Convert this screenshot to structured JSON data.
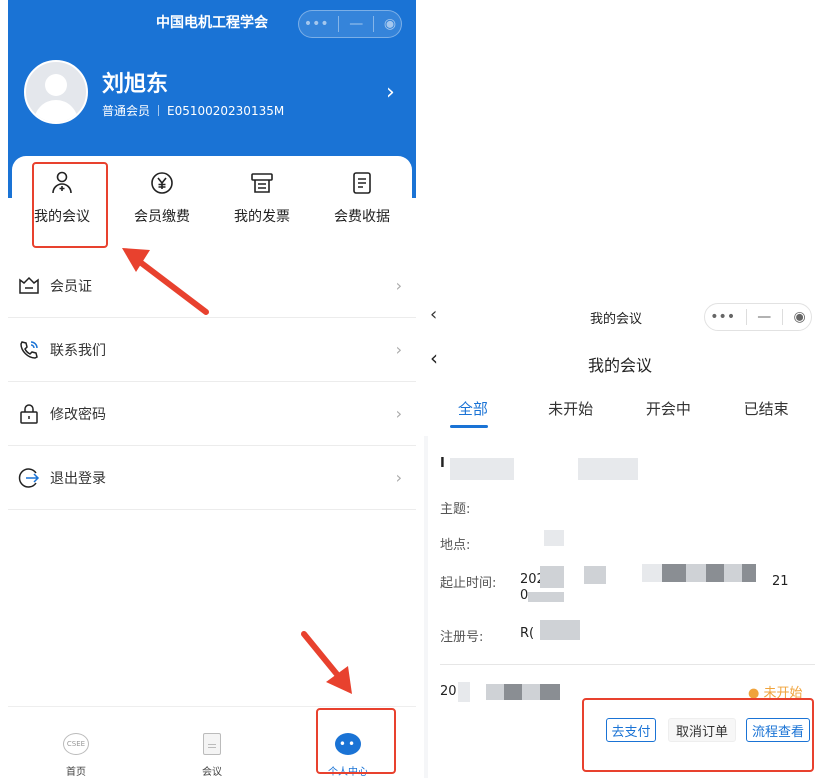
{
  "left": {
    "app_title": "中国电机工程学会",
    "user": {
      "name": "刘旭东",
      "level": "普通会员",
      "member_id": "E0510020230135M"
    },
    "quick_actions": [
      {
        "label": "我的会议",
        "icon": "meeting-person-icon"
      },
      {
        "label": "会员缴费",
        "icon": "yen-icon"
      },
      {
        "label": "我的发票",
        "icon": "invoice-icon"
      },
      {
        "label": "会费收据",
        "icon": "receipt-icon"
      }
    ],
    "menu": [
      {
        "label": "会员证",
        "icon": "crown-card-icon"
      },
      {
        "label": "联系我们",
        "icon": "phone-icon"
      },
      {
        "label": "修改密码",
        "icon": "lock-icon"
      },
      {
        "label": "退出登录",
        "icon": "logout-icon"
      }
    ],
    "tabbar": [
      {
        "label": "首页",
        "icon": "csee-logo-icon",
        "badge": "CSEE"
      },
      {
        "label": "会议",
        "icon": "document-icon"
      },
      {
        "label": "个人中心",
        "icon": "profile-icon",
        "active": true
      }
    ]
  },
  "right": {
    "nav_small_title": "我的会议",
    "nav_title": "我的会议",
    "tabs": [
      "全部",
      "未开始",
      "开会中",
      "已结束"
    ],
    "active_tab": "全部",
    "order": {
      "heading_fragment": "I",
      "fields": {
        "topic_label": "主题:",
        "location_label": "地点:",
        "time_label": "起止时间:",
        "time_value_fragment": "202",
        "time_value_fragment2": "21",
        "time_value_fragment3": "0",
        "regno_label": "注册号:",
        "regno_fragment": "R(",
        "date_fragment": "20"
      },
      "status": "● 未开始",
      "buttons": {
        "pay": "去支付",
        "cancel": "取消订单",
        "process": "流程查看"
      }
    }
  },
  "colors": {
    "brand_blue": "#1a73d5",
    "highlight_red": "#e8412e",
    "status_orange": "#f0a33b"
  }
}
